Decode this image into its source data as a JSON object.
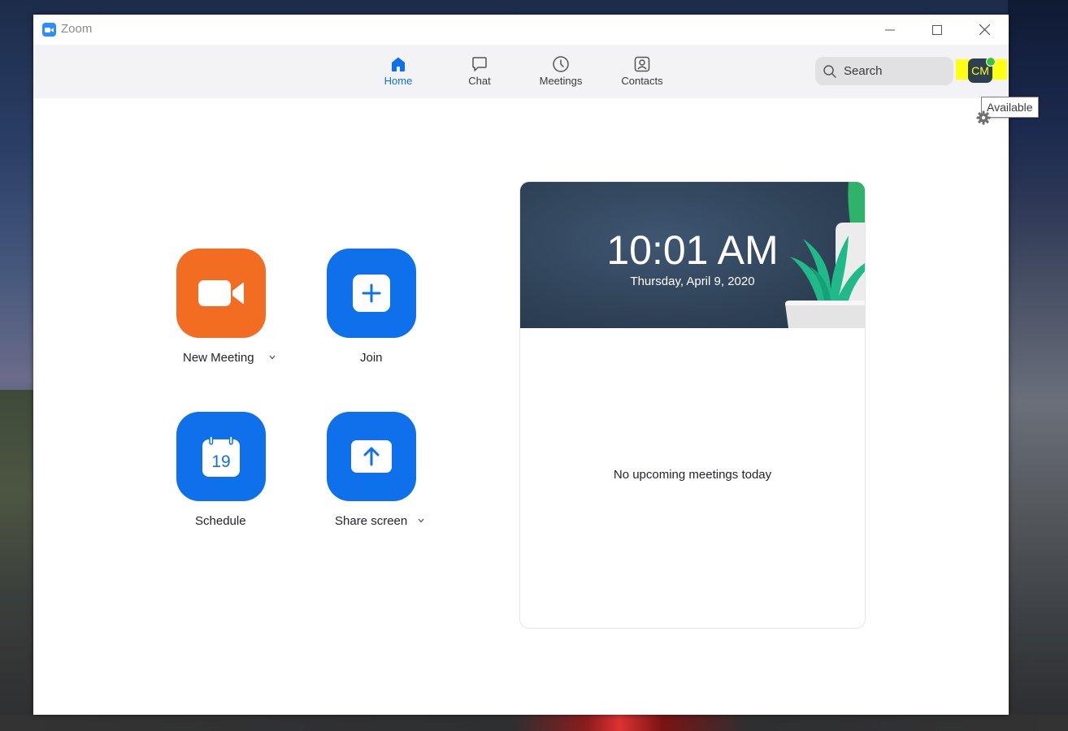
{
  "window": {
    "title": "Zoom"
  },
  "nav": {
    "tabs": [
      {
        "label": "Home",
        "icon": "home-icon",
        "active": true
      },
      {
        "label": "Chat",
        "icon": "chat-icon",
        "active": false
      },
      {
        "label": "Meetings",
        "icon": "clock-icon",
        "active": false
      },
      {
        "label": "Contacts",
        "icon": "contacts-icon",
        "active": false
      }
    ],
    "search": {
      "label": "Search",
      "icon": "search-icon"
    },
    "avatar": {
      "initials": "CM",
      "status": "available"
    },
    "tooltip": "Available"
  },
  "actions": {
    "new_meeting": {
      "label": "New Meeting",
      "icon": "video-camera-icon",
      "color": "#f26d21"
    },
    "join": {
      "label": "Join",
      "icon": "plus-icon",
      "color": "#0e71eb"
    },
    "schedule": {
      "label": "Schedule",
      "icon": "calendar-icon",
      "calendar_day": "19",
      "color": "#0e71eb"
    },
    "share_screen": {
      "label": "Share screen",
      "icon": "upload-arrow-icon",
      "color": "#0e71eb"
    }
  },
  "calendar_card": {
    "time": "10:01 AM",
    "date": "Thursday, April 9, 2020",
    "empty_message": "No upcoming meetings today"
  },
  "colors": {
    "accent": "#0e71eb",
    "orange": "#f26d21",
    "presence_green": "#3ac43a",
    "highlight": "#ffff14"
  }
}
